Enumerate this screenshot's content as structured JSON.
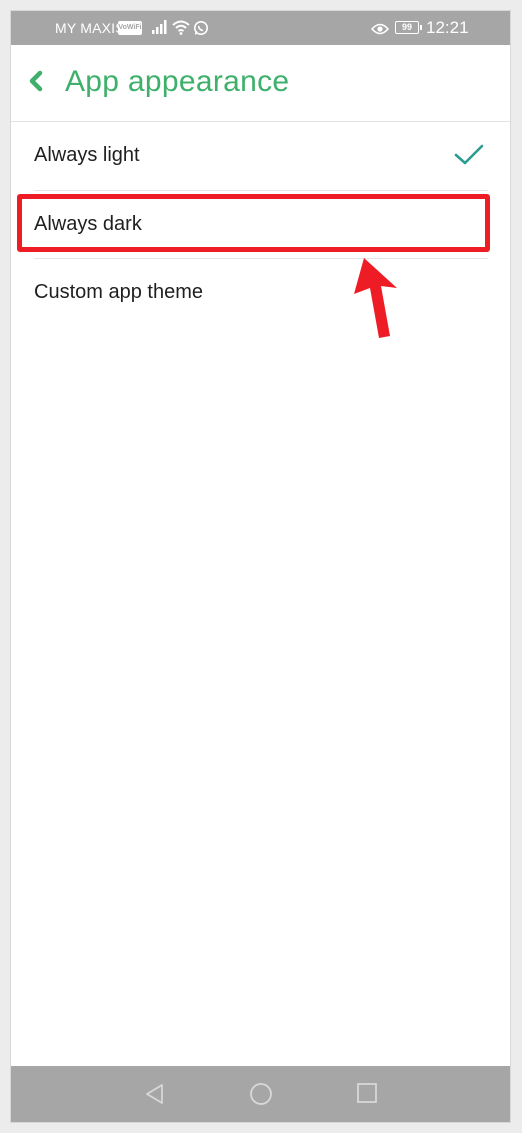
{
  "status_bar": {
    "carrier": "MY MAXIS",
    "vowifi": "VoWiFi",
    "battery": "99",
    "time": "12:21",
    "icons": [
      "signal-icon",
      "wifi-icon",
      "whatsapp-icon",
      "eye-icon",
      "battery-icon"
    ]
  },
  "header": {
    "title": "App appearance",
    "back_icon": "chevron-left-icon"
  },
  "options": [
    {
      "label": "Always light",
      "selected": true
    },
    {
      "label": "Always dark",
      "selected": false
    },
    {
      "label": "Custom app theme",
      "selected": false
    }
  ],
  "annotation": {
    "highlighted_option": "Always dark",
    "color": "#ee1c25"
  },
  "nav_bar": {
    "buttons": [
      "back-triangle-icon",
      "home-circle-icon",
      "recents-square-icon"
    ]
  },
  "colors": {
    "accent": "#3fb06b",
    "check": "#2a9d8f",
    "bars": "#a6a6a6"
  }
}
